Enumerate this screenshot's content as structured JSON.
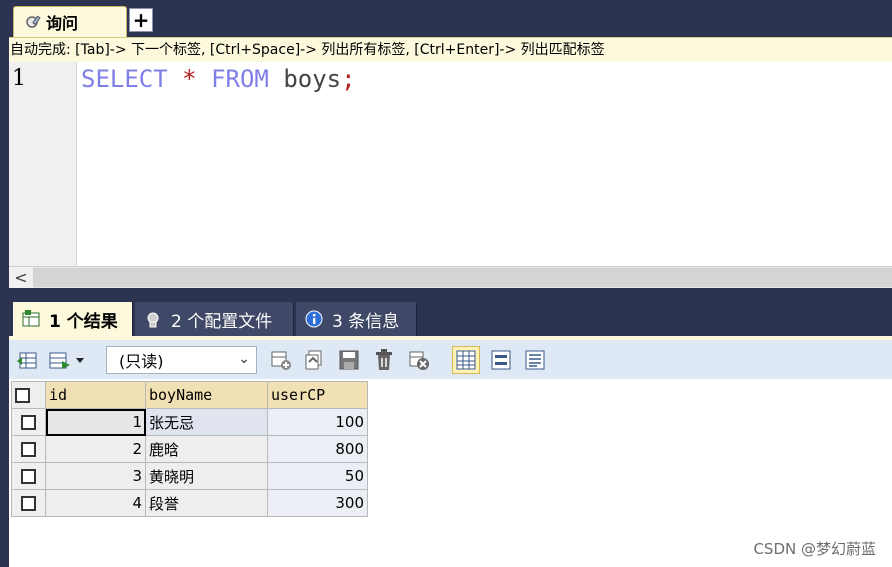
{
  "query_tab": {
    "label": "询问",
    "new_tab_symbol": "+"
  },
  "hint": {
    "text": "自动完成: [Tab]-> 下一个标签, [Ctrl+Space]-> 列出所有标签, [Ctrl+Enter]-> 列出匹配标签"
  },
  "editor": {
    "line_number": "1",
    "tokens": {
      "select": "SELECT",
      "star": "*",
      "from": "FROM",
      "table": "boys",
      "semicolon": ";"
    }
  },
  "scrollbar": {
    "left_arrow": "<"
  },
  "result_tabs": [
    {
      "label": "1 个结果",
      "icon": "result-grid-icon",
      "active": true
    },
    {
      "label": "2 个配置文件",
      "icon": "profile-icon",
      "active": false
    },
    {
      "label": "3 条信息",
      "icon": "info-icon",
      "active": false
    }
  ],
  "toolbar": {
    "readonly_select": "(只读)",
    "icons": [
      "export-icon",
      "import-dropdown-icon",
      "insert-row-icon",
      "duplicate-row-icon",
      "save-icon",
      "delete-icon",
      "cancel-icon",
      "grid-view-icon",
      "form-view-icon",
      "text-view-icon"
    ]
  },
  "grid": {
    "columns": [
      "id",
      "boyName",
      "userCP"
    ],
    "rows": [
      {
        "id": "1",
        "boyName": "张无忌",
        "userCP": "100"
      },
      {
        "id": "2",
        "boyName": "鹿晗",
        "userCP": "800"
      },
      {
        "id": "3",
        "boyName": "黄晓明",
        "userCP": "50"
      },
      {
        "id": "4",
        "boyName": "段誉",
        "userCP": "300"
      }
    ]
  },
  "watermark": "CSDN @梦幻蔚蓝",
  "colors": {
    "frame": "#2b3350",
    "keyword": "#7f7fe8",
    "operator": "#b22222",
    "header": "#f0e0b4",
    "toolbar": "#dfe8f5"
  }
}
